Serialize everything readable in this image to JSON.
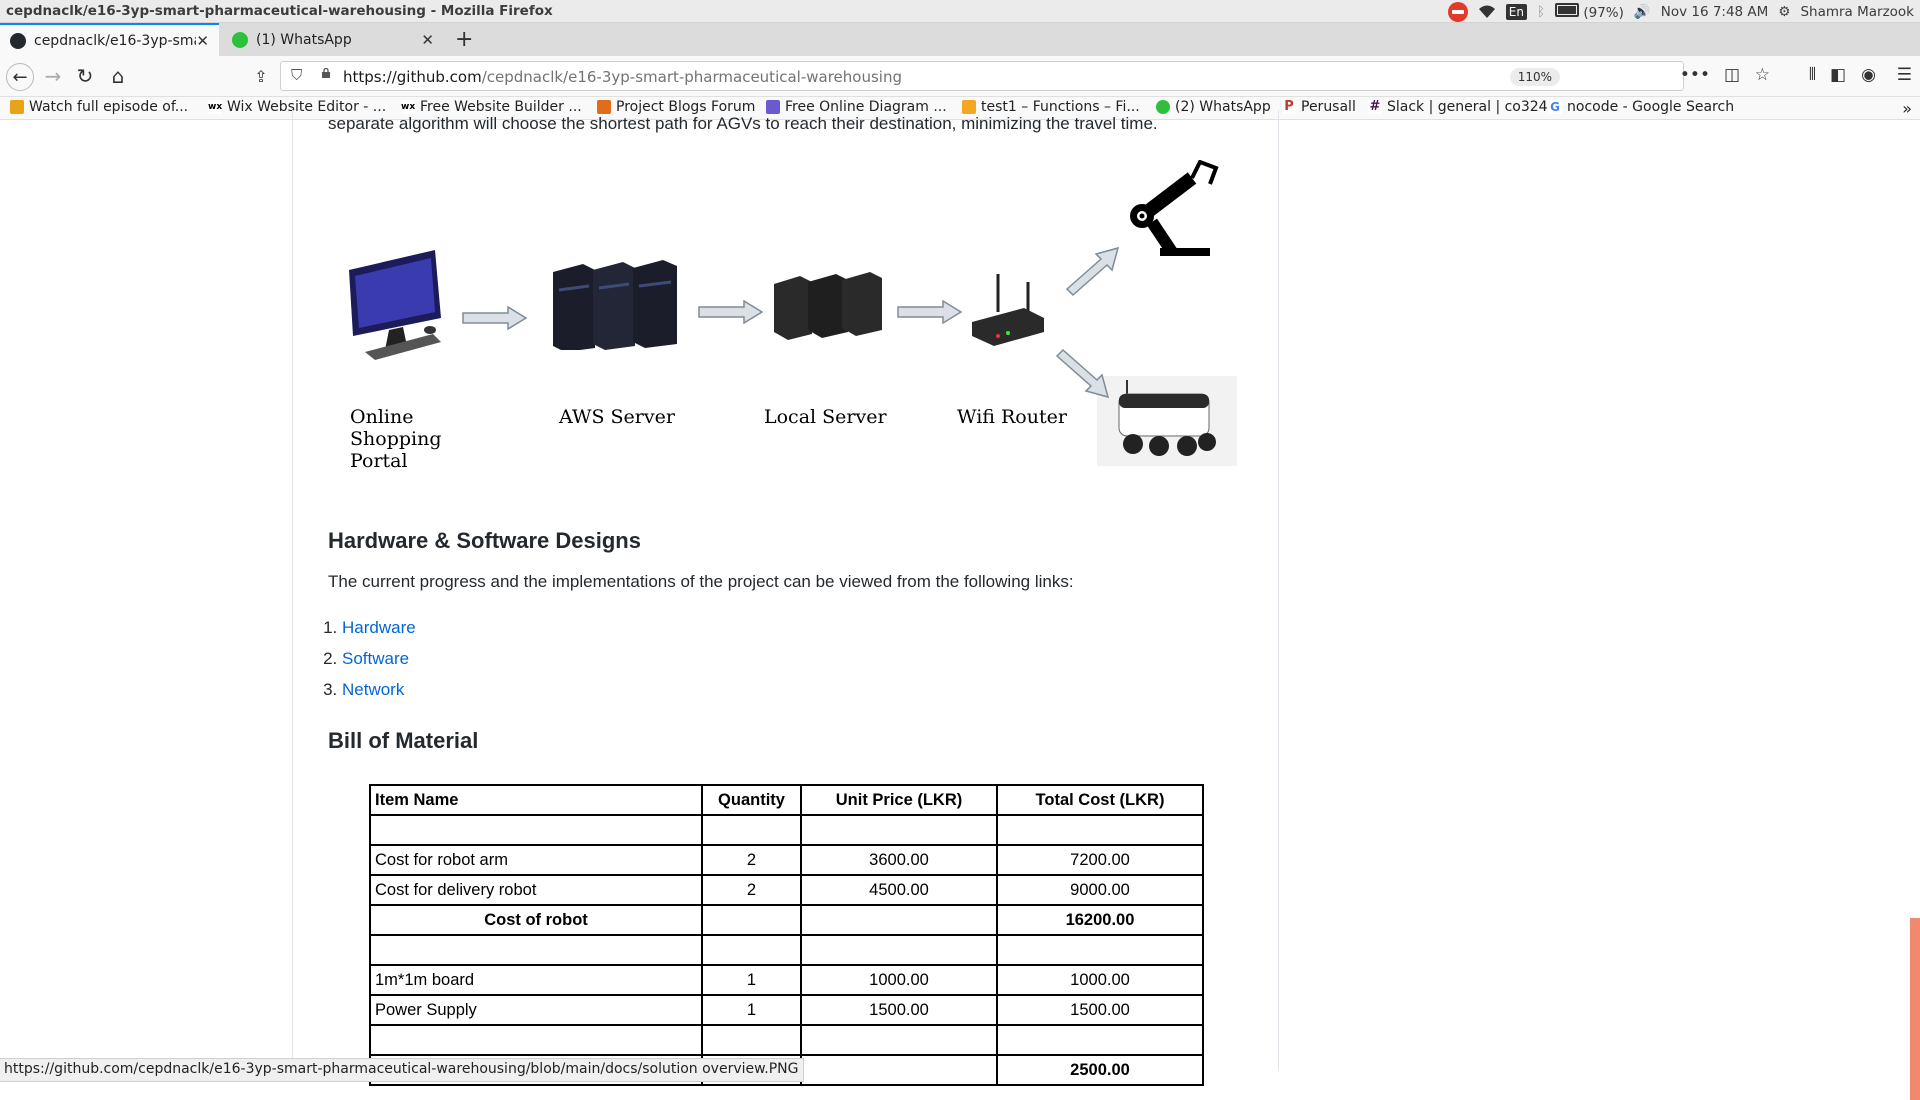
{
  "os": {
    "window_title": "cepdnaclk/e16-3yp-smart-pharmaceutical-warehousing - Mozilla Firefox",
    "lang": "En",
    "battery": "(97%)",
    "datetime": "Nov 16  7:48 AM",
    "user": "Shamra Marzook"
  },
  "tabs": [
    {
      "label": "cepdnaclk/e16-3yp-smar",
      "icon": "github-icon"
    },
    {
      "label": "(1) WhatsApp",
      "icon": "whatsapp-icon"
    }
  ],
  "nav": {
    "url_host": "https://github.com",
    "url_path": "/cepdnaclk/e16-3yp-smart-pharmaceutical-warehousing",
    "zoom": "110%"
  },
  "bookmarks": [
    {
      "label": "Watch full episode of...",
      "icon_color": "#e8a317"
    },
    {
      "label": "Wix Website Editor - ...",
      "icon_color": "#000000"
    },
    {
      "label": "Free Website Builder ...",
      "icon_color": "#000000"
    },
    {
      "label": "Project Blogs Forum",
      "icon_color": "#e06c1c"
    },
    {
      "label": "Free Online Diagram ...",
      "icon_color": "#6a5acd"
    },
    {
      "label": "test1 – Functions – Fi...",
      "icon_color": "#f5a623"
    },
    {
      "label": "(2) WhatsApp",
      "icon_color": "#2fbf3e"
    },
    {
      "label": "Perusall",
      "icon_color": "#c0392b"
    },
    {
      "label": "Slack | general | co324",
      "icon_color": "#4a154b"
    },
    {
      "label": "nocode - Google Search",
      "icon_color": "#4285f4"
    }
  ],
  "page": {
    "cut_off_text": "separate algorithm will choose the shortest path for AGVs to reach their destination, minimizing the travel time.",
    "diagram": {
      "labels": [
        "Online\nShopping\nPortal",
        "AWS Server",
        "Local Server",
        "Wifi Router"
      ]
    },
    "hw_sw": {
      "heading": "Hardware & Software Designs",
      "intro": "The current progress and the implementations of the project can be viewed from the following links:",
      "links": [
        "Hardware",
        "Software",
        "Network"
      ]
    },
    "bom": {
      "heading": "Bill of Material",
      "headers": [
        "Item Name",
        "Quantity",
        "Unit Price (LKR)",
        "Total Cost (LKR)"
      ],
      "rows": [
        {
          "name": "",
          "qty": "",
          "unit": "",
          "total": "",
          "type": "blank"
        },
        {
          "name": "Cost for robot arm",
          "qty": "2",
          "unit": "3600.00",
          "total": "7200.00",
          "type": "item"
        },
        {
          "name": "Cost for delivery robot",
          "qty": "2",
          "unit": "4500.00",
          "total": "9000.00",
          "type": "item"
        },
        {
          "name": "Cost of robot",
          "qty": "",
          "unit": "",
          "total": "16200.00",
          "type": "subtotal"
        },
        {
          "name": "",
          "qty": "",
          "unit": "",
          "total": "",
          "type": "blank"
        },
        {
          "name": "1m*1m board",
          "qty": "1",
          "unit": "1000.00",
          "total": "1000.00",
          "type": "item"
        },
        {
          "name": "Power Supply",
          "qty": "1",
          "unit": "1500.00",
          "total": "1500.00",
          "type": "item"
        },
        {
          "name": "",
          "qty": "",
          "unit": "",
          "total": "",
          "type": "blank"
        },
        {
          "name": "",
          "qty": "",
          "unit": "",
          "total": "2500.00",
          "type": "subtotal"
        }
      ]
    }
  },
  "status_url": "https://github.com/cepdnaclk/e16-3yp-smart-pharmaceutical-warehousing/blob/main/docs/solution overview.PNG"
}
